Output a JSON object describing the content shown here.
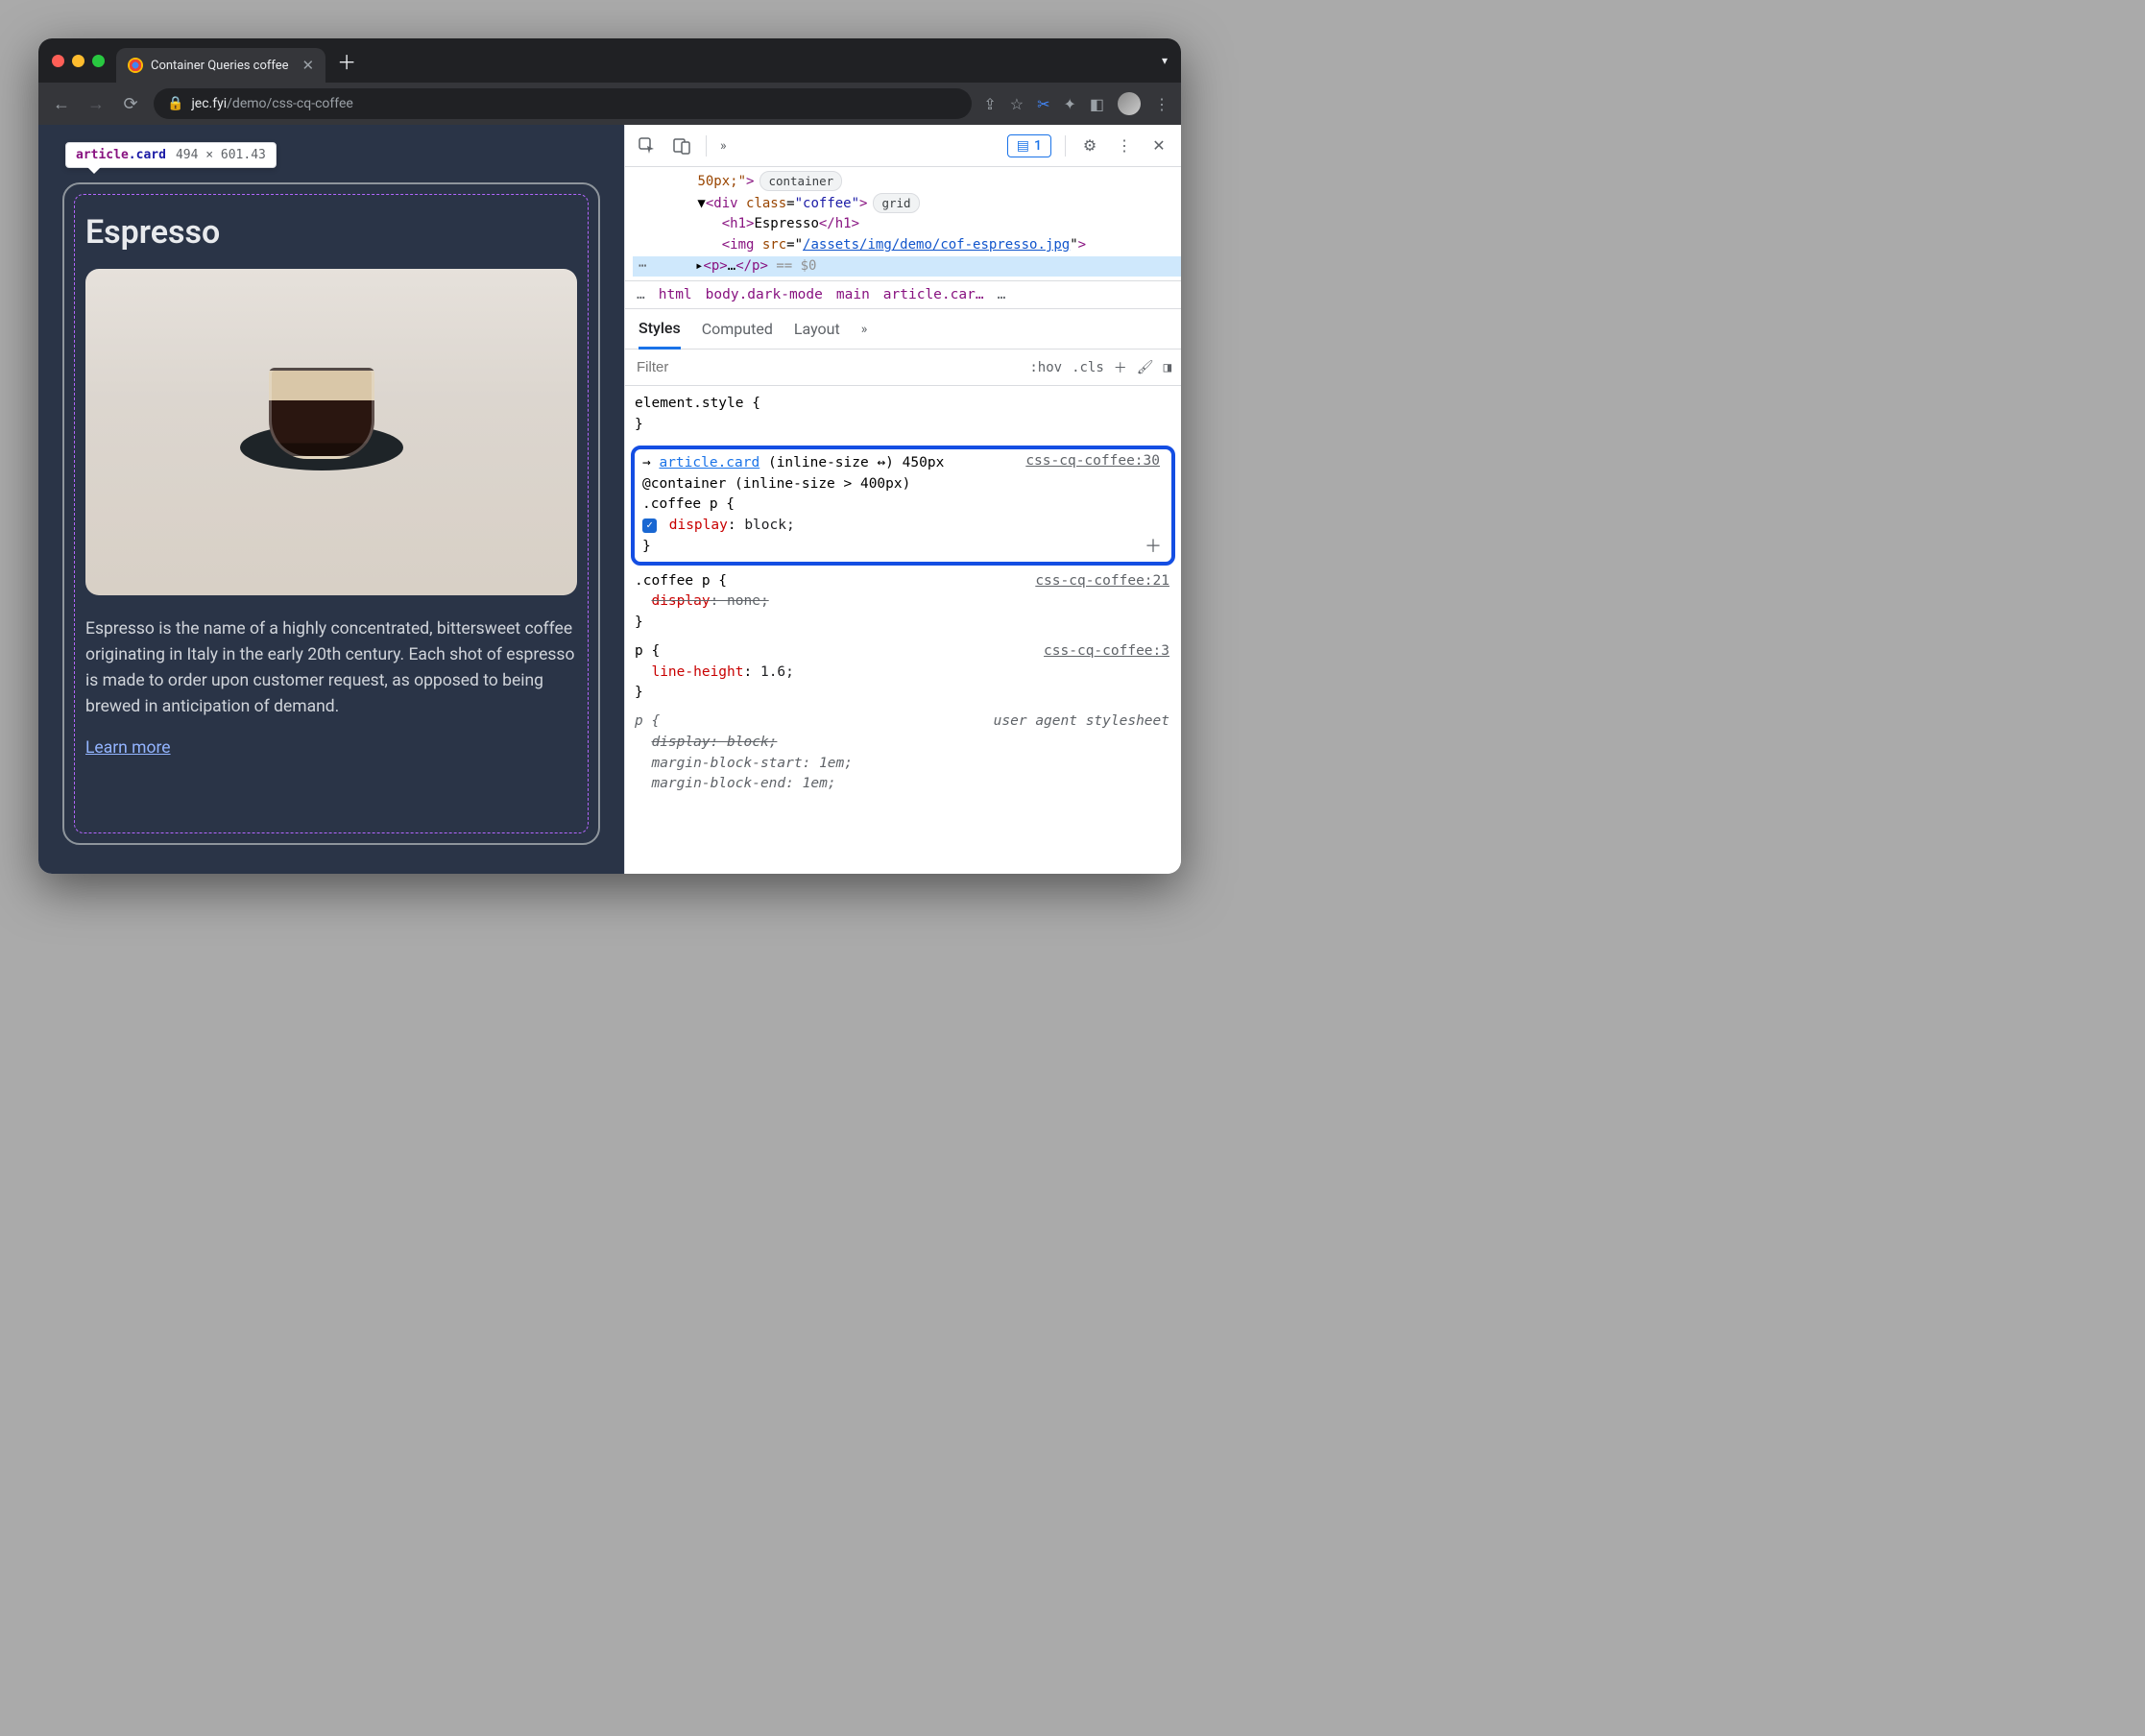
{
  "browser": {
    "tab_title": "Container Queries coffee",
    "url_domain": "jec.fyi",
    "url_path": "/demo/css-cq-coffee",
    "messages_count": "1"
  },
  "tooltip": {
    "tag": "article",
    "cls": ".card",
    "dimensions": "494 × 601.43"
  },
  "page": {
    "heading": "Espresso",
    "body": "Espresso is the name of a highly concentrated, bittersweet coffee originating in Italy in the early 20th century. Each shot of espresso is made to order upon customer request, as opposed to being brewed in anticipation of demand.",
    "learn": "Learn more"
  },
  "elements": {
    "style_attr": "50px;\"",
    "badge_container": "container",
    "div_open": "<div class=\"coffee\">",
    "badge_grid": "grid",
    "h1": "<h1>Espresso</h1>",
    "img_prefix": "<img src=\"",
    "img_src": "/assets/img/demo/cof-espresso.jpg",
    "img_suffix": "\">",
    "p_collapsed": "<p>…</p>",
    "eq": "== $0"
  },
  "breadcrumb": {
    "pre": "…",
    "items": [
      "html",
      "body.dark-mode",
      "main",
      "article.car…"
    ],
    "post": "…"
  },
  "styles": {
    "tabs": [
      "Styles",
      "Computed",
      "Layout"
    ],
    "filter_placeholder": "Filter",
    "hov": ":hov",
    "cls": ".cls",
    "element_style": "element.style {",
    "close": "}",
    "cq_selector": "article.card",
    "cq_info": "(inline-size ↔) 450px",
    "cq_at": "@container (inline-size > 400px)",
    "rule1_selector": ".coffee p {",
    "rule1_src": "css-cq-coffee:30",
    "rule1_prop": "display",
    "rule1_val": "block;",
    "rule2_selector": ".coffee p {",
    "rule2_src": "css-cq-coffee:21",
    "rule2_prop": "display",
    "rule2_val": "none;",
    "rule3_selector": "p {",
    "rule3_src": "css-cq-coffee:3",
    "rule3_prop": "line-height",
    "rule3_val": "1.6;",
    "rule4_selector": "p {",
    "rule4_src": "user agent stylesheet",
    "rule4_p1": "display",
    "rule4_v1": "block;",
    "rule4_p2": "margin-block-start",
    "rule4_v2": "1em;",
    "rule4_p3": "margin-block-end",
    "rule4_v3": "1em;"
  }
}
